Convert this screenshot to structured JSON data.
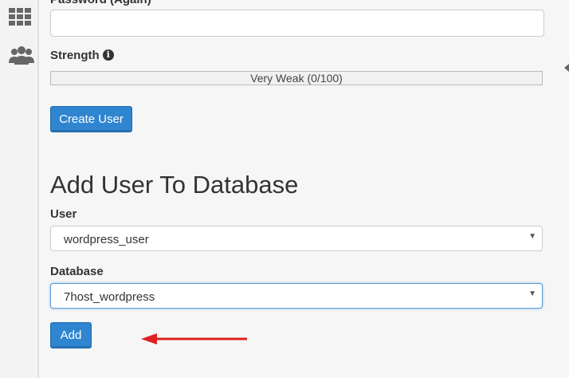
{
  "sidebar": {
    "icons": [
      "grid-apps-icon",
      "users-group-icon"
    ]
  },
  "form": {
    "password_again_label": "Password (Again)",
    "password_again_value": "",
    "strength_label": "Strength",
    "strength_text": "Very Weak (0/100)",
    "strength_score": 0,
    "create_button": "Create User"
  },
  "add_user_section": {
    "title": "Add User To Database",
    "user_label": "User",
    "user_value": "wordpress_user",
    "database_label": "Database",
    "database_value": "7host_wordpress",
    "add_button": "Add"
  },
  "colors": {
    "primary_button": "#2f85d0",
    "annotation_arrow": "#e02020"
  }
}
